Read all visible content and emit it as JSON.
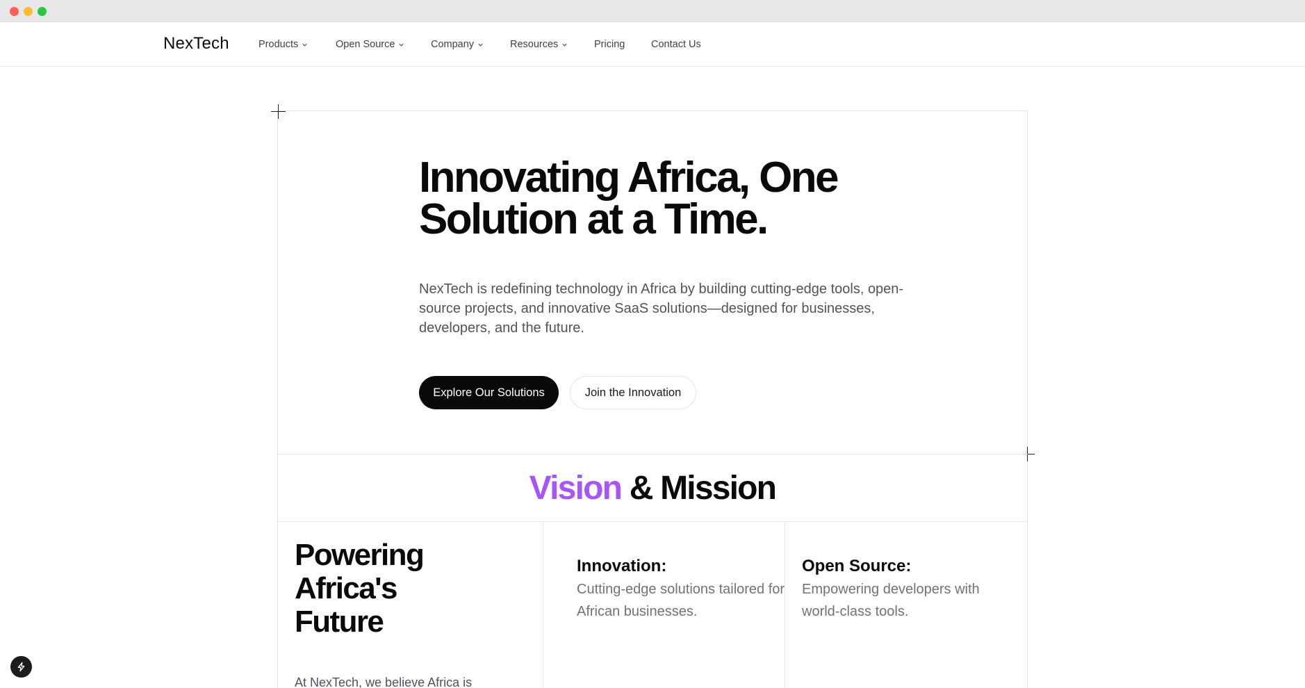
{
  "window": {
    "buttons": [
      "close",
      "minimize",
      "zoom"
    ]
  },
  "nav": {
    "logo": "NexTech",
    "items": [
      {
        "label": "Products",
        "has_dropdown": true
      },
      {
        "label": "Open Source",
        "has_dropdown": true
      },
      {
        "label": "Company",
        "has_dropdown": true
      },
      {
        "label": "Resources",
        "has_dropdown": true
      },
      {
        "label": "Pricing",
        "has_dropdown": false
      },
      {
        "label": "Contact Us",
        "has_dropdown": false
      }
    ]
  },
  "hero": {
    "title_line1": "Innovating Africa, One",
    "title_line2": "Solution at a Time.",
    "description": "NexTech is redefining technology in Africa by building cutting-edge tools, open-source projects, and innovative SaaS solutions—designed for businesses, developers, and the future.",
    "primary_button": "Explore Our Solutions",
    "secondary_button": "Join the Innovation"
  },
  "vision": {
    "heading_accent": "Vision",
    "heading_rest": "& Mission",
    "accent_color": "#a855f7",
    "big_title_line1": "Powering",
    "big_title_line2": "Africa's",
    "big_title_line3": "Future",
    "body_start": "At NexTech, we believe Africa is",
    "columns": [
      {
        "title": "Innovation:",
        "text": "Cutting-edge solutions tailored for African businesses."
      },
      {
        "title": "Open Source:",
        "text": "Empowering developers with world-class tools."
      }
    ]
  },
  "badge": {
    "icon": "bolt-icon"
  }
}
